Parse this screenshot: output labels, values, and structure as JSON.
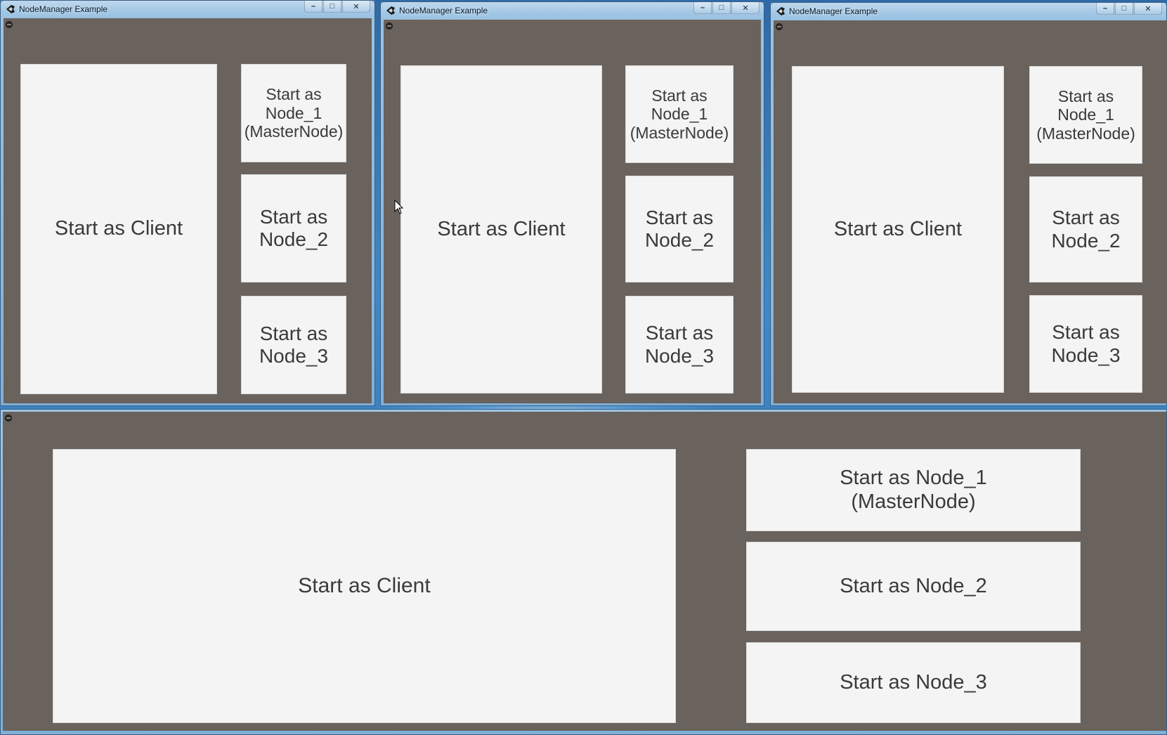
{
  "windows": [
    {
      "title": "NodeManager Example",
      "buttons": {
        "client": "Start as Client",
        "node1": "Start as\nNode_1\n(MasterNode)",
        "node2": "Start as\nNode_2",
        "node3": "Start as\nNode_3"
      }
    },
    {
      "title": "NodeManager Example",
      "buttons": {
        "client": "Start as Client",
        "node1": "Start as\nNode_1\n(MasterNode)",
        "node2": "Start as\nNode_2",
        "node3": "Start as\nNode_3"
      }
    },
    {
      "title": "NodeManager Example",
      "buttons": {
        "client": "Start as Client",
        "node1": "Start as\nNode_1\n(MasterNode)",
        "node2": "Start as\nNode_2",
        "node3": "Start as\nNode_3"
      }
    },
    {
      "title": "",
      "buttons": {
        "client": "Start as Client",
        "node1": "Start as Node_1\n(MasterNode)",
        "node2": "Start as Node_2",
        "node3": "Start as Node_3"
      }
    }
  ],
  "icons": {
    "app": "unity-icon",
    "system_menu": "system-menu-icon",
    "minimize": "minimize-icon",
    "maximize": "maximize-icon",
    "close": "close-icon",
    "cursor": "mouse-cursor-icon"
  },
  "colors": {
    "client_bg": "#6a625c",
    "button_bg": "#f4f4f4",
    "button_text": "#3a3a3a"
  }
}
